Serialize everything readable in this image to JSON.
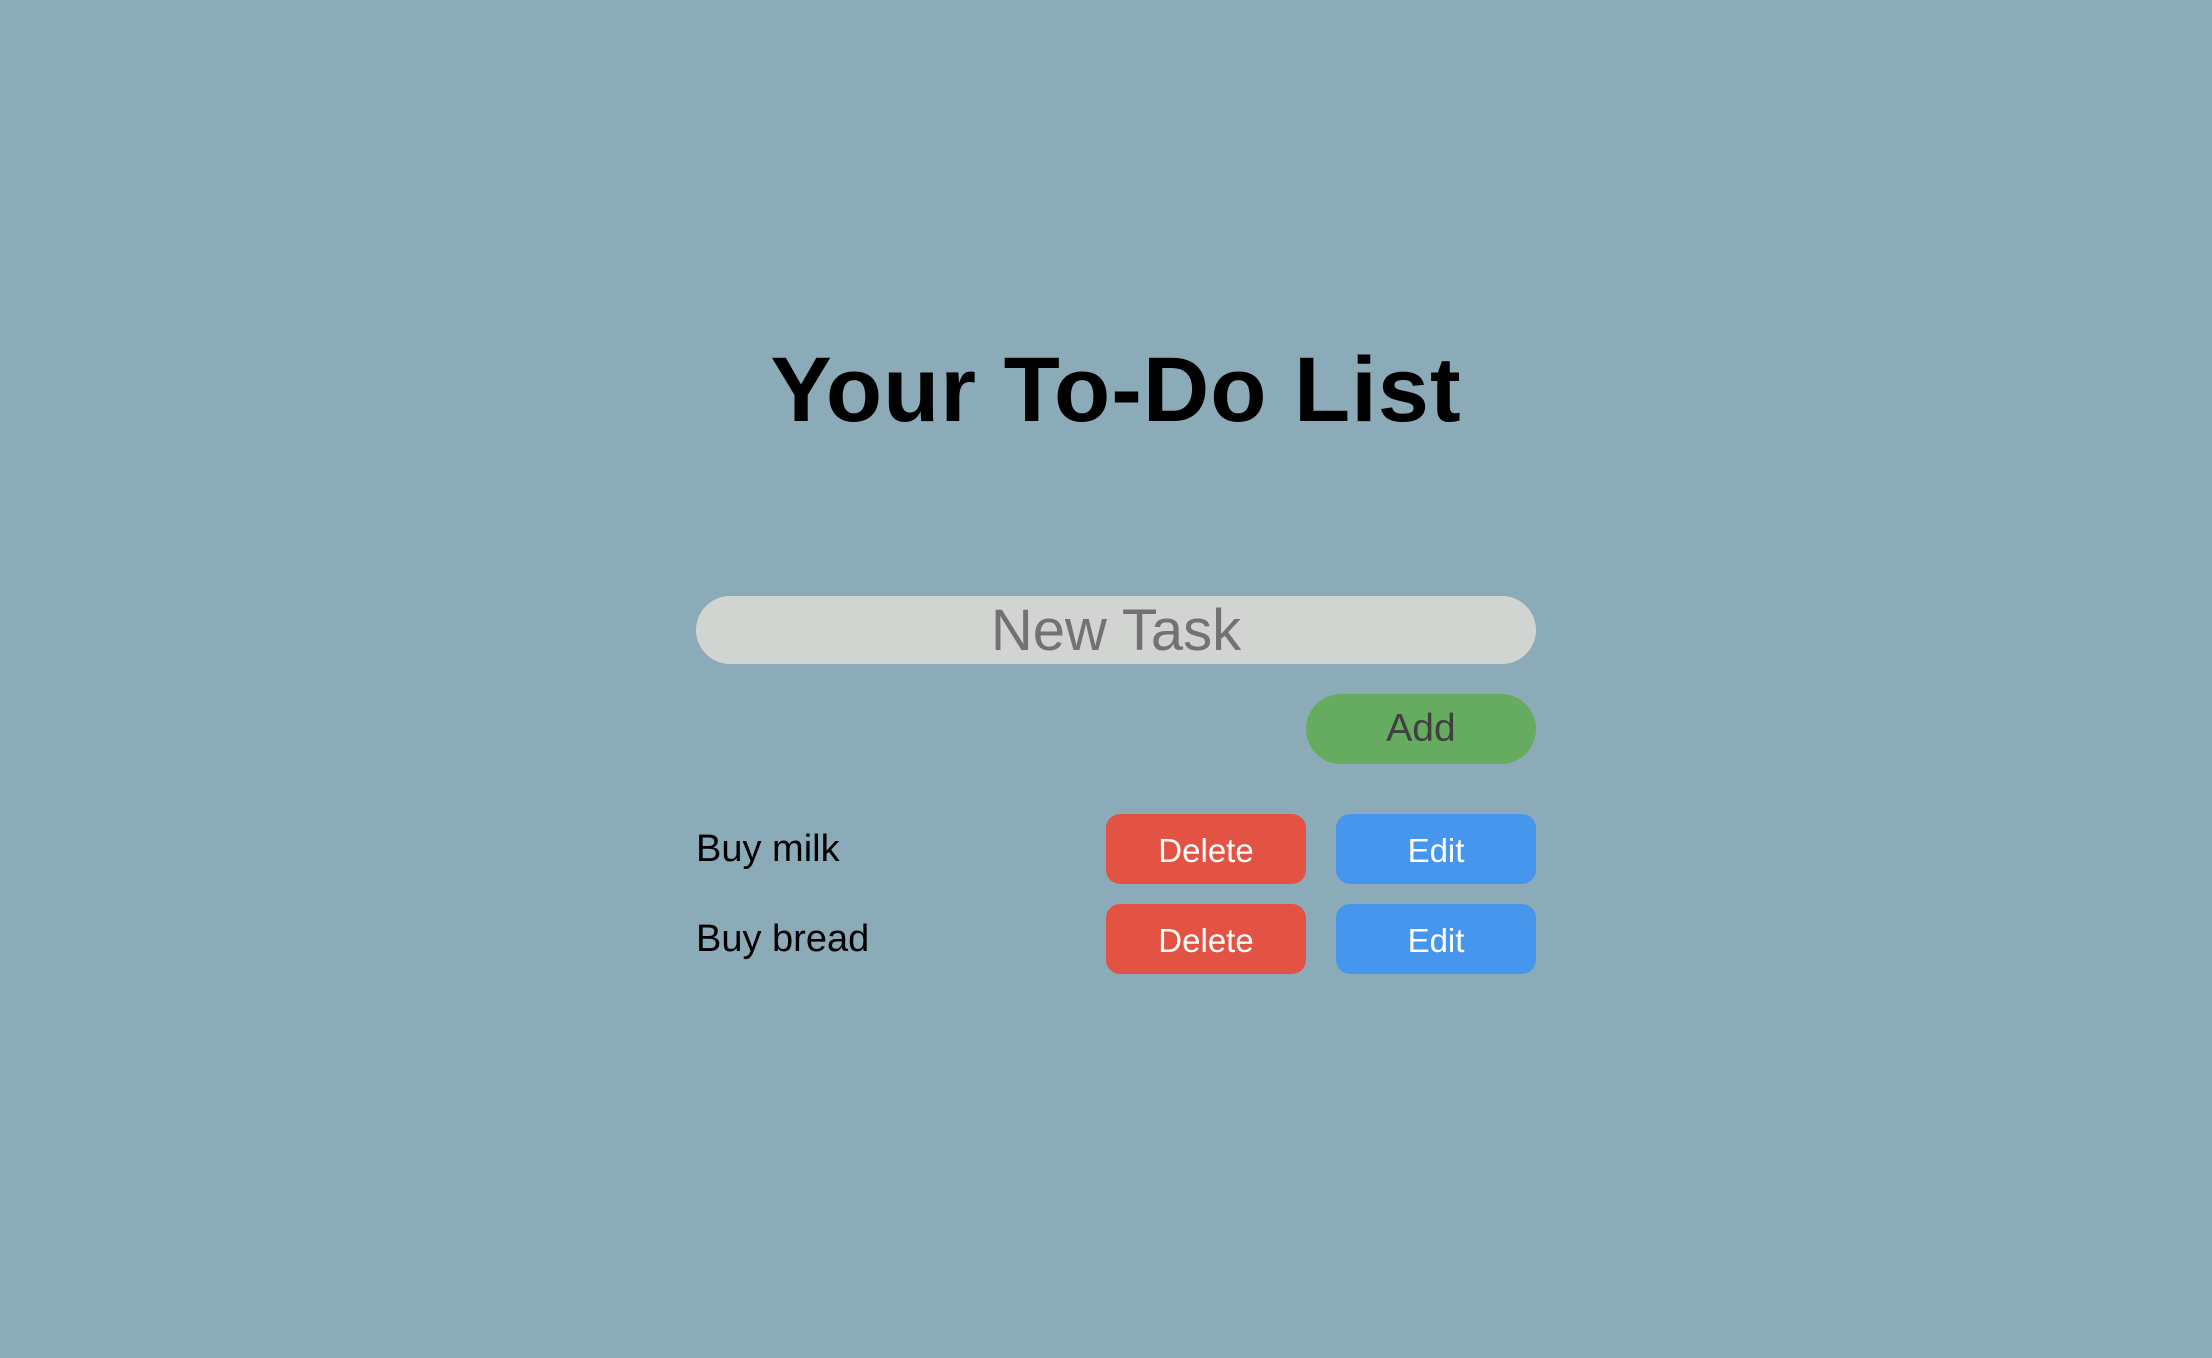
{
  "app": {
    "title": "Your To-Do List"
  },
  "colors": {
    "background": "#8cabb8",
    "input_bg": "#d1d4d1",
    "add_button": "#65ab60",
    "delete_button": "#e25343",
    "edit_button": "#4796ee"
  },
  "new_task": {
    "placeholder": "New Task",
    "value": ""
  },
  "add_button": {
    "label": "Add"
  },
  "tasks": [
    {
      "label": "Buy milk",
      "delete_label": "Delete",
      "edit_label": "Edit"
    },
    {
      "label": "Buy bread",
      "delete_label": "Delete",
      "edit_label": "Edit"
    }
  ]
}
